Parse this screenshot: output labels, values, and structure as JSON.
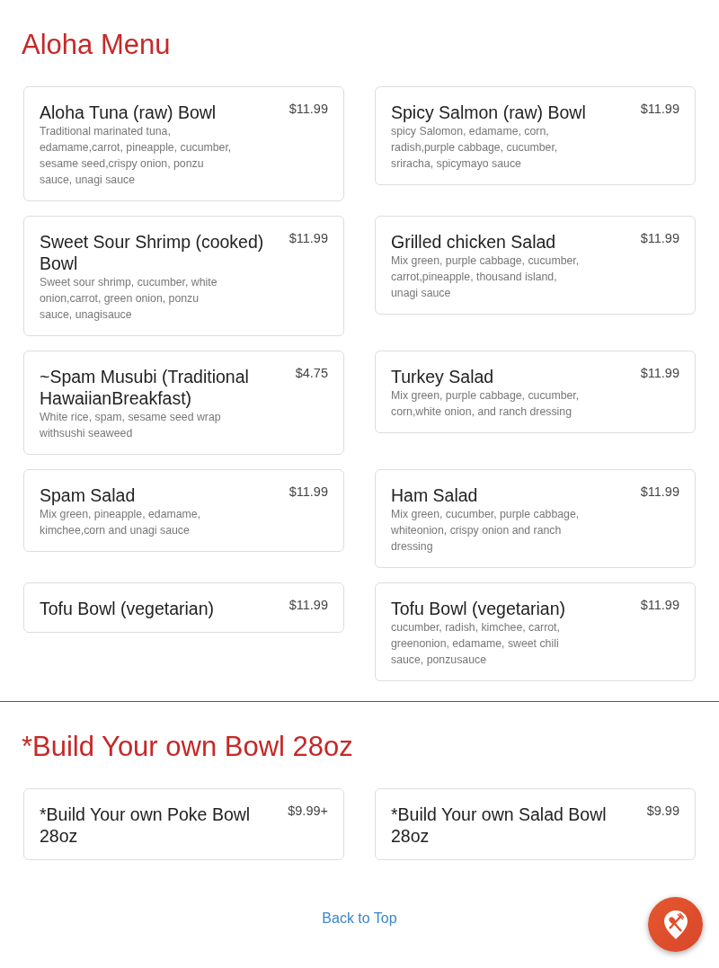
{
  "sections": [
    {
      "title": "Aloha Menu",
      "items": [
        {
          "name": "Aloha Tuna (raw) Bowl",
          "price": "$11.99",
          "description": "Traditional marinated tuna, edamame,carrot, pineapple, cucumber, sesame seed,crispy onion, ponzu sauce, unagi sauce"
        },
        {
          "name": "Spicy Salmon (raw) Bowl",
          "price": "$11.99",
          "description": "spicy Salomon, edamame, corn, radish,purple cabbage, cucumber, sriracha, spicymayo sauce"
        },
        {
          "name": "Sweet Sour Shrimp (cooked) Bowl",
          "price": "$11.99",
          "description": "Sweet sour shrimp, cucumber, white onion,carrot, green onion, ponzu sauce, unagisauce"
        },
        {
          "name": "Grilled chicken Salad",
          "price": "$11.99",
          "description": "Mix green, purple cabbage, cucumber, carrot,pineapple, thousand island, unagi sauce"
        },
        {
          "name": "~Spam Musubi (Traditional HawaiianBreakfast)",
          "price": "$4.75",
          "description": "White rice, spam, sesame seed wrap withsushi seaweed"
        },
        {
          "name": "Turkey Salad",
          "price": "$11.99",
          "description": "Mix green, purple cabbage, cucumber, corn,white onion, and ranch dressing"
        },
        {
          "name": "Spam Salad",
          "price": "$11.99",
          "description": "Mix green, pineapple, edamame, kimchee,corn and unagi sauce"
        },
        {
          "name": "Ham Salad",
          "price": "$11.99",
          "description": "Mix green, cucumber, purple cabbage, whiteonion, crispy onion and ranch dressing"
        },
        {
          "name": "Tofu Bowl (vegetarian)",
          "price": "$11.99"
        },
        {
          "name": "Tofu Bowl (vegetarian)",
          "price": "$11.99",
          "description": "cucumber, radish, kimchee, carrot, greenonion, edamame, sweet chili sauce, ponzusauce"
        }
      ]
    },
    {
      "title": "*Build Your own Bowl 28oz",
      "items": [
        {
          "name": "*Build Your own Poke Bowl 28oz",
          "price": "$9.99+"
        },
        {
          "name": "*Build Your own Salad Bowl 28oz",
          "price": "$9.99"
        }
      ]
    }
  ],
  "back_to_top": "Back to Top"
}
